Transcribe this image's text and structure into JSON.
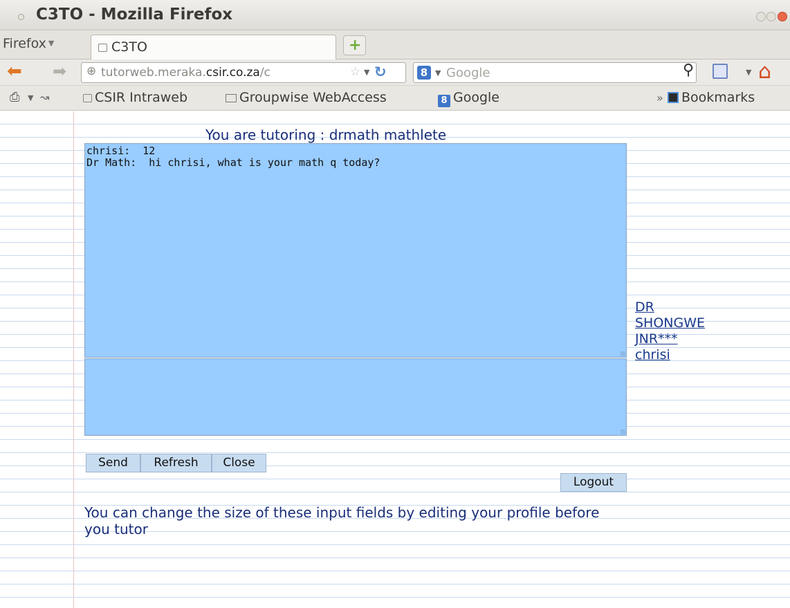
{
  "window": {
    "title": "C3TO - Mozilla Firefox"
  },
  "tabbar": {
    "menu_label": "Firefox",
    "tabs": [
      {
        "label": "C3TO"
      }
    ]
  },
  "navbar": {
    "url_prefix": "tutorweb.meraka.",
    "url_domain": "csir.co.za",
    "url_suffix": "/c",
    "search_placeholder": "Google"
  },
  "bookmarks": {
    "items": [
      {
        "label": "CSIR Intraweb",
        "icon": "page-icon"
      },
      {
        "label": "Groupwise WebAccess",
        "icon": "mail-icon"
      },
      {
        "label": "Google",
        "icon": "google-icon"
      }
    ],
    "overflow_label": "»",
    "menu_label": "Bookmarks"
  },
  "tutor": {
    "heading": "You are tutoring : drmath mathlete",
    "chat_lines": [
      "chrisi:  12",
      "Dr Math:  hi chrisi, what is your math q today?"
    ],
    "message_value": "",
    "users": [
      "DR",
      "SHONGWE",
      "JNR***",
      "chrisi"
    ],
    "buttons": {
      "send": "Send",
      "refresh": "Refresh",
      "close": "Close",
      "logout": "Logout"
    },
    "hint": "You can change the size of these input fields by editing your profile before you tutor"
  }
}
